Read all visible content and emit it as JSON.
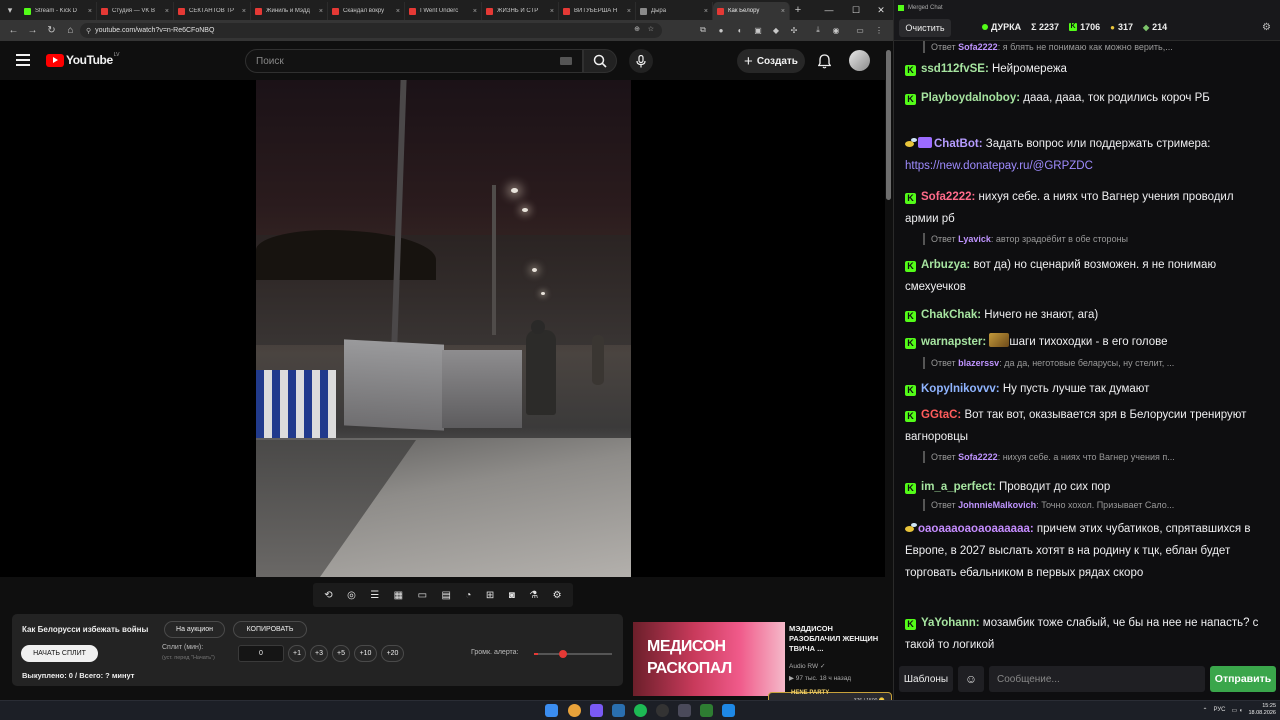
{
  "browser": {
    "tabs": [
      {
        "title": "Stream - Kick D",
        "color": "#53fc18",
        "active": false
      },
      {
        "title": "Студия — VK В",
        "color": "#e53935",
        "active": false
      },
      {
        "title": "СЕКТАНТОВ ТР",
        "color": "#e53935",
        "active": false
      },
      {
        "title": "Жиниль и Мэдд",
        "color": "#e53935",
        "active": false
      },
      {
        "title": "Скандал вокру",
        "color": "#e53935",
        "active": false
      },
      {
        "title": "I Went Underc",
        "color": "#e53935",
        "active": false
      },
      {
        "title": "ЖИЗНЬ И СТР",
        "color": "#e53935",
        "active": false
      },
      {
        "title": "ВИТУБЕРША Н",
        "color": "#e53935",
        "active": false
      },
      {
        "title": "Дыра",
        "color": "#8a8a8a",
        "active": false
      },
      {
        "title": "Как Белору",
        "color": "#e53935",
        "active": true
      }
    ],
    "url": "youtube.com/watch?v=n-Re6CFoNBQ"
  },
  "youtube": {
    "logo_text": "YouTube",
    "country_code": "LV",
    "search_placeholder": "Поиск",
    "create_label": "Создать"
  },
  "split_panel": {
    "title": "Как Белорусси избежать войны",
    "auction_label": "На аукцион",
    "copy_label": "КОПИРОВАТЬ",
    "start_label": "НАЧАТЬ СПЛИТ",
    "split_label": "Сплит (мин):",
    "split_hint": "(уст. перед \"Начать\")",
    "split_value": "0",
    "increments": [
      "+1",
      "+3",
      "+5",
      "+10",
      "+20"
    ],
    "alert_volume_label": "Громк. алерта:",
    "alert_volume": 0.05,
    "status": "Выкуплено: 0 / Всего: ? минут"
  },
  "recommendation": {
    "thumb_line1": "МЕДИСОН",
    "thumb_line2": "РАСКОПАЛ",
    "title": "МЭДДИСОН РАЗОБЛАЧИЛ ЖЕНЩИН ТВИЧА ...",
    "channel": "Audio RW ✓",
    "meta": "▶ 97 тыс.  18 ч назад"
  },
  "party": {
    "name": "HENE PARTY",
    "count": "376 / 1500 🪙"
  },
  "taskbar": {
    "lang": "РУС",
    "time": "15:25",
    "date": "18.08.2026"
  },
  "chat": {
    "window_title": "Merged Chat",
    "clear_label": "Очистить",
    "streamer": "ДУРКА",
    "total": "Σ 2237",
    "kick_count": "1706",
    "other_count": "317",
    "other2_count": "214",
    "input_placeholder": "Сообщение...",
    "templates_label": "Шаблоны",
    "send_label": "Отправить",
    "items": [
      {
        "kind": "reply",
        "prefix": "Ответ",
        "user": "Sofa2222",
        "text": ": я блять не понимаю как можно верить,..."
      },
      {
        "kind": "msg",
        "badge": "K",
        "user": "ssd112fvSE",
        "color": "#a6e4a0",
        "text": "Нейромережа"
      },
      {
        "kind": "msg",
        "badge": "K",
        "user": "Playboydalnoboy",
        "color": "#a6e4a0",
        "text": "дааа, дааа, ток родились короч РБ"
      },
      {
        "kind": "msg",
        "badge": "bee",
        "user": "ChatBot",
        "color": "#b69cff",
        "text": "Задать вопрос или поддержать стримера: ",
        "link": "https://new.donatepay.ru/@GRPZDC"
      },
      {
        "kind": "msg",
        "badge": "K",
        "user": "Sofa2222",
        "color": "#ff6b8a",
        "text": "нихуя себе. а ниях что Вагнер учения проводил армии рб"
      },
      {
        "kind": "reply",
        "prefix": "Ответ",
        "user": "Lyavick",
        "text": ": автор зрадоёбит в обе стороны"
      },
      {
        "kind": "msg",
        "badge": "K",
        "user": "Arbuzya",
        "color": "#a6e4a0",
        "text": "вот да) но сценарий возможен. я не понимаю смехуечков"
      },
      {
        "kind": "msg",
        "badge": "K",
        "user": "ChakChak",
        "color": "#a6e4a0",
        "text": "Ничего не знают, ага)"
      },
      {
        "kind": "msg",
        "badge": "K",
        "user": "warnapster",
        "color": "#a6e4a0",
        "text": "шаги тихоходки - в его голове",
        "emote": true
      },
      {
        "kind": "reply",
        "prefix": "Ответ",
        "user": "blazerssv",
        "text": ": да да, неготовые беларусы, ну стелит, ..."
      },
      {
        "kind": "msg",
        "badge": "K",
        "user": "Kopylnikovvv",
        "color": "#8fb4ff",
        "text": "Ну пусть лучше так думают"
      },
      {
        "kind": "msg",
        "badge": "K",
        "user": "GGtaC",
        "color": "#ff5c5c",
        "text": "Вот так вот, оказывается зря в Белорусии тренируют вагноровцы"
      },
      {
        "kind": "reply",
        "prefix": "Ответ",
        "user": "Sofa2222",
        "text": ": нихуя себе. а ниях что Вагнер учения п..."
      },
      {
        "kind": "msg",
        "badge": "K",
        "user": "im_a_perfect",
        "color": "#a6e4a0",
        "text": "Проводит до сих пор"
      },
      {
        "kind": "reply",
        "prefix": "Ответ",
        "user": "JohnnieMalkovich",
        "text": ": Точно хохол. Призывает Сало..."
      },
      {
        "kind": "msg",
        "badge": "bee",
        "user": "оаоаааоаоаоаааааа",
        "color": "#c58cff",
        "text": "причем этих чубатиков, спрятавшихся в Европе, в 2027 выслать хотят в на родину к тцк, еблан будет торговать ебальником в первых рядах скоро"
      },
      {
        "kind": "msg",
        "badge": "K",
        "user": "YaYohann",
        "color": "#a6e4a0",
        "text": "мозамбик тоже слабый, че бы на нее не напасть? с такой то логикой"
      }
    ]
  }
}
